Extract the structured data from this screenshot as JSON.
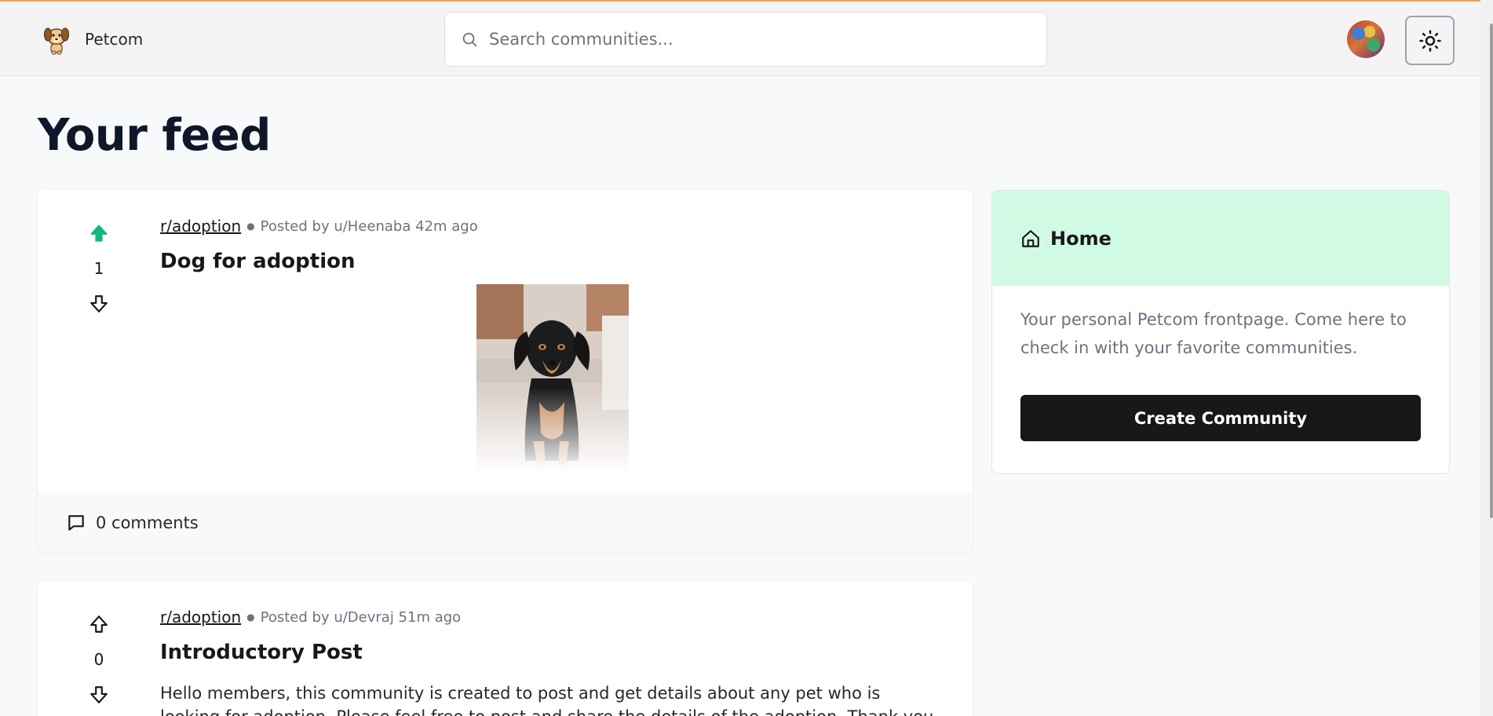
{
  "header": {
    "brand_name": "Petcom",
    "logo_icon": "dog-face-icon",
    "search_placeholder": "Search communities...",
    "theme_toggle_icon": "sun-icon"
  },
  "main": {
    "page_title": "Your feed",
    "posts": [
      {
        "subreddit": "r/adoption",
        "meta": "Posted by u/Heenaba 42m ago",
        "title": "Dog for adoption",
        "votes": "1",
        "upvoted": true,
        "has_image": true,
        "comments": "0 comments"
      },
      {
        "subreddit": "r/adoption",
        "meta": "Posted by u/Devraj 51m ago",
        "title": "Introductory Post",
        "votes": "0",
        "upvoted": false,
        "body": "Hello members, this community is created to post and get details about any pet who is looking for adoption. Please feel free to post and share the details of the adoption. Thank you."
      }
    ]
  },
  "sidebar": {
    "title": "Home",
    "description": "Your personal Petcom frontpage. Come here to check in with your favorite communities.",
    "create_button": "Create Community"
  },
  "colors": {
    "upvote_active": "#10b981",
    "sidebar_header_bg": "#d1fae5",
    "primary_button": "#18181b",
    "top_accent": "#e8a35a"
  }
}
